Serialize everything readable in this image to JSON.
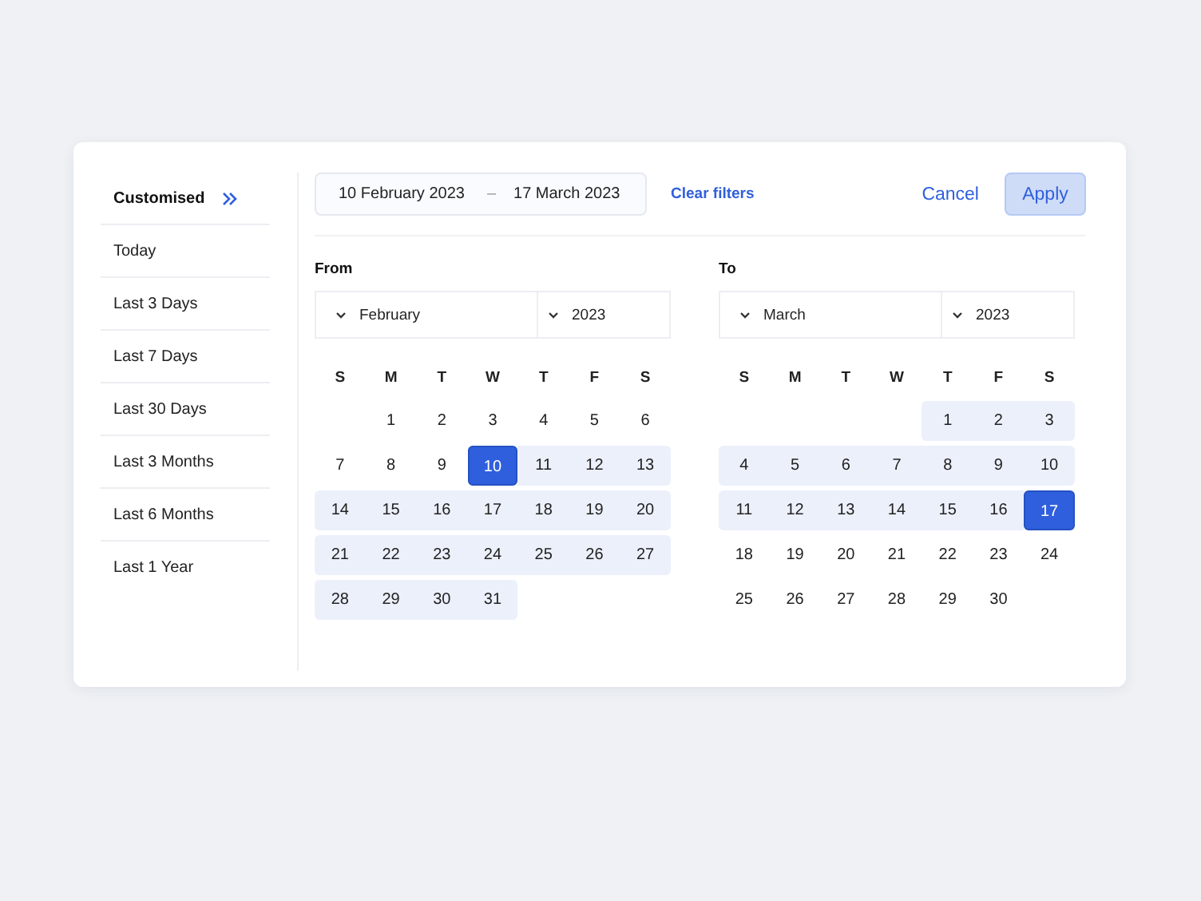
{
  "presets": [
    {
      "label": "Customised",
      "selected": true
    },
    {
      "label": "Today",
      "selected": false
    },
    {
      "label": "Last 3 Days",
      "selected": false
    },
    {
      "label": "Last 7 Days",
      "selected": false
    },
    {
      "label": "Last 30 Days",
      "selected": false
    },
    {
      "label": "Last 3 Months",
      "selected": false
    },
    {
      "label": "Last 6 Months",
      "selected": false
    },
    {
      "label": "Last 1 Year",
      "selected": false
    }
  ],
  "range_field": {
    "start": "10 February 2023",
    "separator": "–",
    "end": "17 March 2023"
  },
  "clear_filters": "Clear filters",
  "cancel": "Cancel",
  "apply": "Apply",
  "calendars": [
    {
      "label": "From",
      "month": "February",
      "year": "2023",
      "weekdays": [
        "S",
        "M",
        "T",
        "W",
        "T",
        "F",
        "S"
      ],
      "weeks": [
        {
          "kind": "leading",
          "days": [
            {
              "label": "1",
              "selected": false,
              "in_range": false
            },
            {
              "label": "2",
              "selected": false,
              "in_range": false
            },
            {
              "label": "3",
              "selected": false,
              "in_range": false
            },
            {
              "label": "4",
              "selected": false,
              "in_range": false
            },
            {
              "label": "5",
              "selected": false,
              "in_range": false
            },
            {
              "label": "6",
              "selected": false,
              "in_range": false
            }
          ]
        },
        {
          "kind": "trailing",
          "days": [
            {
              "label": "7",
              "selected": false,
              "in_range": false
            },
            {
              "label": "8",
              "selected": false,
              "in_range": false
            },
            {
              "label": "9",
              "selected": false,
              "in_range": false
            },
            {
              "label": "10",
              "selected": true,
              "in_range": true
            },
            {
              "label": "11",
              "selected": false,
              "in_range": true
            },
            {
              "label": "12",
              "selected": false,
              "in_range": true
            },
            {
              "label": "13",
              "selected": false,
              "in_range": true
            }
          ]
        },
        {
          "kind": "trailing",
          "days": [
            {
              "label": "14",
              "selected": false,
              "in_range": true
            },
            {
              "label": "15",
              "selected": false,
              "in_range": true
            },
            {
              "label": "16",
              "selected": false,
              "in_range": true
            },
            {
              "label": "17",
              "selected": false,
              "in_range": true
            },
            {
              "label": "18",
              "selected": false,
              "in_range": true
            },
            {
              "label": "19",
              "selected": false,
              "in_range": true
            },
            {
              "label": "20",
              "selected": false,
              "in_range": true
            }
          ]
        },
        {
          "kind": "trailing",
          "days": [
            {
              "label": "21",
              "selected": false,
              "in_range": true
            },
            {
              "label": "22",
              "selected": false,
              "in_range": true
            },
            {
              "label": "23",
              "selected": false,
              "in_range": true
            },
            {
              "label": "24",
              "selected": false,
              "in_range": true
            },
            {
              "label": "25",
              "selected": false,
              "in_range": true
            },
            {
              "label": "26",
              "selected": false,
              "in_range": true
            },
            {
              "label": "27",
              "selected": false,
              "in_range": true
            }
          ]
        },
        {
          "kind": "trailing",
          "days": [
            {
              "label": "28",
              "selected": false,
              "in_range": true
            },
            {
              "label": "29",
              "selected": false,
              "in_range": true
            },
            {
              "label": "30",
              "selected": false,
              "in_range": true
            },
            {
              "label": "31",
              "selected": false,
              "in_range": true
            }
          ]
        }
      ]
    },
    {
      "label": "To",
      "month": "March",
      "year": "2023",
      "weekdays": [
        "S",
        "M",
        "T",
        "W",
        "T",
        "F",
        "S"
      ],
      "weeks": [
        {
          "kind": "leading",
          "days": [
            {
              "label": "1",
              "selected": false,
              "in_range": true
            },
            {
              "label": "2",
              "selected": false,
              "in_range": true
            },
            {
              "label": "3",
              "selected": false,
              "in_range": true
            }
          ]
        },
        {
          "kind": "trailing",
          "days": [
            {
              "label": "4",
              "selected": false,
              "in_range": true
            },
            {
              "label": "5",
              "selected": false,
              "in_range": true
            },
            {
              "label": "6",
              "selected": false,
              "in_range": true
            },
            {
              "label": "7",
              "selected": false,
              "in_range": true
            },
            {
              "label": "8",
              "selected": false,
              "in_range": true
            },
            {
              "label": "9",
              "selected": false,
              "in_range": true
            },
            {
              "label": "10",
              "selected": false,
              "in_range": true
            }
          ]
        },
        {
          "kind": "trailing",
          "days": [
            {
              "label": "11",
              "selected": false,
              "in_range": true
            },
            {
              "label": "12",
              "selected": false,
              "in_range": true
            },
            {
              "label": "13",
              "selected": false,
              "in_range": true
            },
            {
              "label": "14",
              "selected": false,
              "in_range": true
            },
            {
              "label": "15",
              "selected": false,
              "in_range": true
            },
            {
              "label": "16",
              "selected": false,
              "in_range": true
            },
            {
              "label": "17",
              "selected": true,
              "in_range": true
            }
          ]
        },
        {
          "kind": "trailing",
          "days": [
            {
              "label": "18",
              "selected": false,
              "in_range": false
            },
            {
              "label": "19",
              "selected": false,
              "in_range": false
            },
            {
              "label": "20",
              "selected": false,
              "in_range": false
            },
            {
              "label": "21",
              "selected": false,
              "in_range": false
            },
            {
              "label": "22",
              "selected": false,
              "in_range": false
            },
            {
              "label": "23",
              "selected": false,
              "in_range": false
            },
            {
              "label": "24",
              "selected": false,
              "in_range": false
            }
          ]
        },
        {
          "kind": "trailing",
          "days": [
            {
              "label": "25",
              "selected": false,
              "in_range": false
            },
            {
              "label": "26",
              "selected": false,
              "in_range": false
            },
            {
              "label": "27",
              "selected": false,
              "in_range": false
            },
            {
              "label": "28",
              "selected": false,
              "in_range": false
            },
            {
              "label": "29",
              "selected": false,
              "in_range": false
            },
            {
              "label": "30",
              "selected": false,
              "in_range": false
            }
          ]
        }
      ]
    }
  ]
}
